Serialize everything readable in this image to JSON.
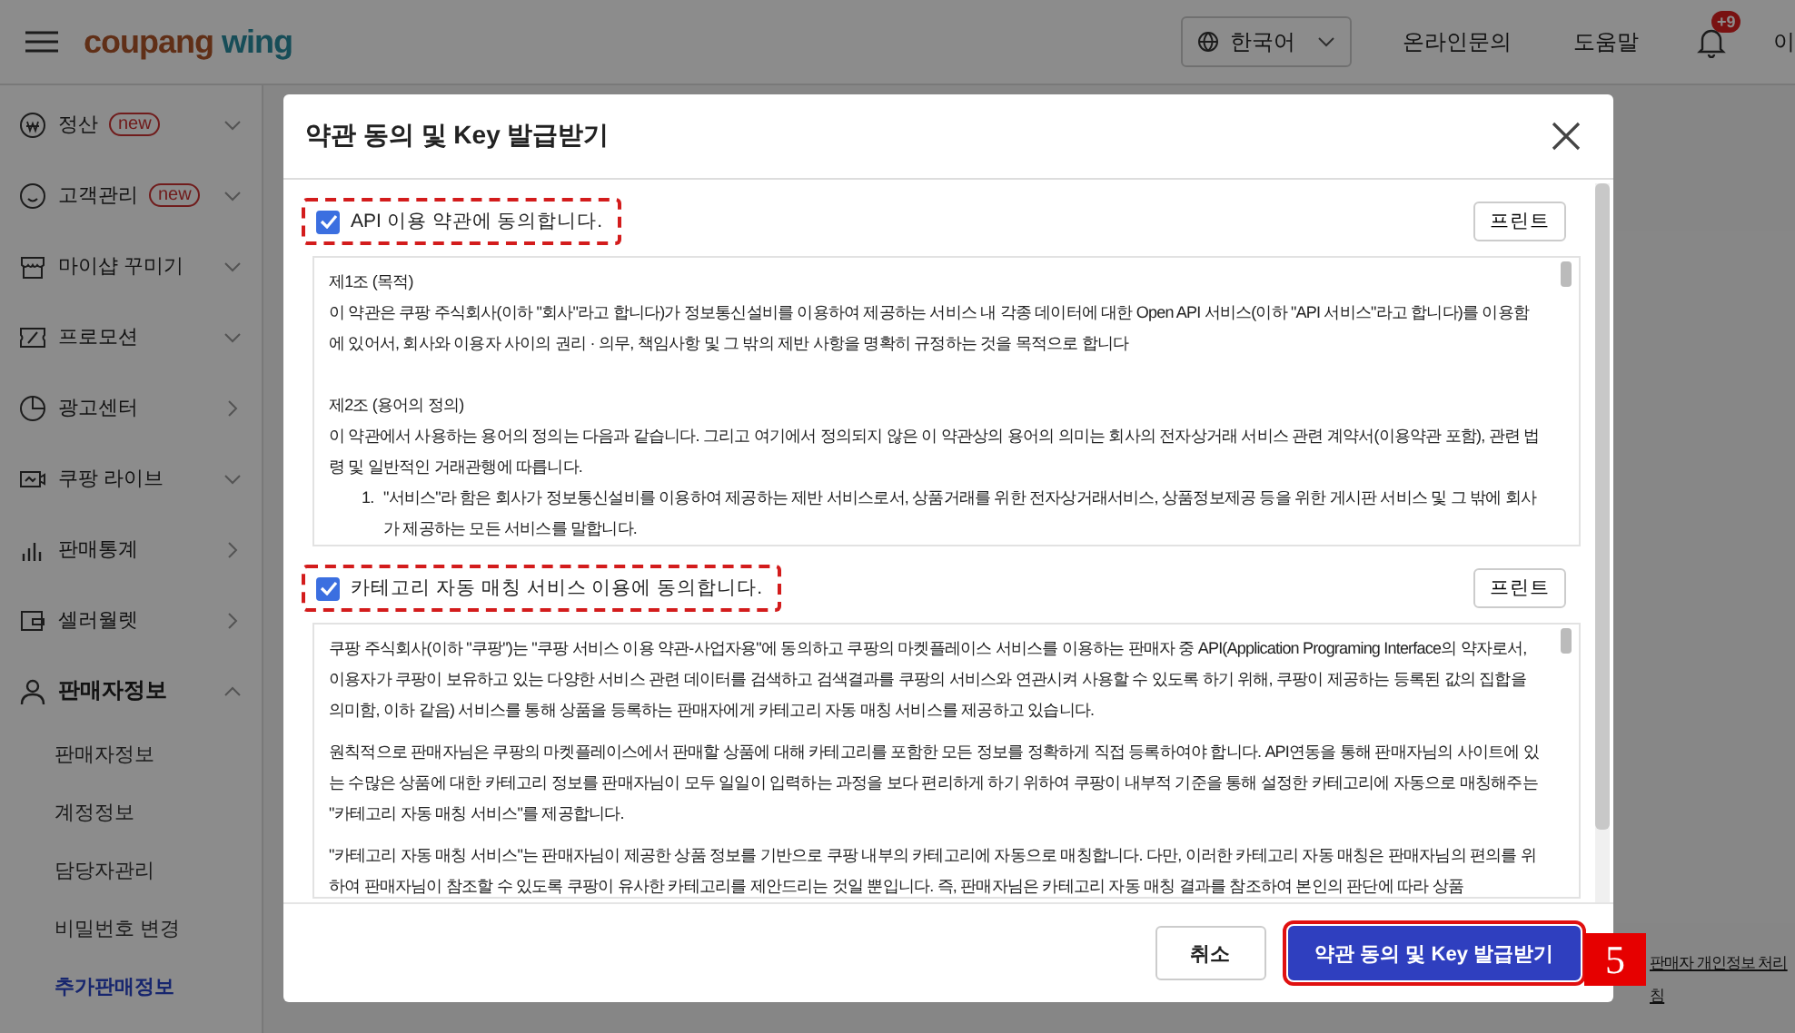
{
  "header": {
    "logo": {
      "brand": "coupang",
      "product": "wing"
    },
    "language": "한국어",
    "links": [
      "온라인문의",
      "도움말"
    ],
    "notification_badge": "+9",
    "user_initial": "이"
  },
  "sidebar": {
    "items": [
      {
        "label": "정산",
        "badge": "new",
        "expandable": true,
        "expanded": false
      },
      {
        "label": "고객관리",
        "badge": "new",
        "expandable": true,
        "expanded": false
      },
      {
        "label": "마이샵 꾸미기",
        "expandable": true,
        "expanded": false
      },
      {
        "label": "프로모션",
        "expandable": true,
        "expanded": false
      },
      {
        "label": "광고센터",
        "expandable": false,
        "expanded": false
      },
      {
        "label": "쿠팡 라이브",
        "expandable": true,
        "expanded": false
      },
      {
        "label": "판매통계",
        "expandable": false,
        "expanded": false
      },
      {
        "label": "셀러월렛",
        "expandable": false,
        "expanded": false
      },
      {
        "label": "판매자정보",
        "expandable": true,
        "expanded": true,
        "children": [
          {
            "label": "판매자정보",
            "selected": false
          },
          {
            "label": "계정정보",
            "selected": false
          },
          {
            "label": "담당자관리",
            "selected": false
          },
          {
            "label": "비밀번호 변경",
            "selected": false
          },
          {
            "label": "추가판매정보",
            "selected": true
          }
        ]
      }
    ]
  },
  "background_link": [
    "판매자 개인정보 처리",
    "침"
  ],
  "modal": {
    "title": "약관 동의 및 Key 발급받기",
    "sections": [
      {
        "agree_label": "API 이용 약관에 동의합니다.",
        "checked": true,
        "highlighted": true,
        "print_button": "프린트",
        "paragraphs": [
          {
            "kind": "heading",
            "text": "제1조 (목적)"
          },
          {
            "kind": "text",
            "text": "이 약관은 쿠팡 주식회사(이하 \"회사\"라고 합니다)가 정보통신설비를 이용하여 제공하는 서비스 내 각종 데이터에 대한 Open API 서비스(이하 \"API 서비스\"라고 합니다)를 이용함에 있어서, 회사와 이용자 사이의 권리 · 의무, 책임사항 및 그 밖의 제반 사항을 명확히 규정하는 것을 목적으로 합니다"
          },
          {
            "kind": "heading",
            "text": "제2조 (용어의 정의)"
          },
          {
            "kind": "text",
            "text": "이 약관에서 사용하는 용어의 정의는 다음과 같습니다. 그리고 여기에서 정의되지 않은 이 약관상의 용어의 의미는 회사의 전자상거래 서비스 관련 계약서(이용약관 포함), 관련 법령 및 일반적인 거래관행에 따릅니다."
          },
          {
            "kind": "list_item",
            "marker": "1.",
            "text": "\"서비스\"라 함은 회사가 정보통신설비를 이용하여 제공하는 제반 서비스로서, 상품거래를 위한 전자상거래서비스, 상품정보제공 등을 위한 게시판 서비스 및 그 밖에 회사가 제공하는 모든 서비스를 말합니다."
          }
        ]
      },
      {
        "agree_label": "카테고리 자동 매칭 서비스 이용에 동의합니다.",
        "checked": true,
        "highlighted": true,
        "print_button": "프린트",
        "paragraphs": [
          {
            "kind": "text",
            "text": "쿠팡 주식회사(이하 \"쿠팡\")는 \"쿠팡 서비스 이용 약관-사업자용\"에 동의하고 쿠팡의 마켓플레이스 서비스를 이용하는 판매자 중 API(Application Programing Interface의 약자로서, 이용자가 쿠팡이 보유하고 있는 다양한 서비스 관련 데이터를 검색하고 검색결과를 쿠팡의 서비스와 연관시켜 사용할 수 있도록 하기 위해, 쿠팡이 제공하는 등록된 값의 집합을 의미함, 이하 같음) 서비스를 통해 상품을 등록하는 판매자에게 카테고리 자동 매칭 서비스를 제공하고 있습니다."
          },
          {
            "kind": "text",
            "text": "원칙적으로 판매자님은 쿠팡의 마켓플레이스에서 판매할 상품에 대해 카테고리를 포함한 모든 정보를 정확하게 직접 등록하여야 합니다. API연동을 통해 판매자님의 사이트에 있는 수많은 상품에 대한 카테고리 정보를 판매자님이 모두 일일이 입력하는 과정을 보다 편리하게 하기 위하여 쿠팡이 내부적 기준을 통해 설정한 카테고리에 자동으로 매칭해주는 \"카테고리 자동 매칭 서비스\"를 제공합니다."
          },
          {
            "kind": "text",
            "text": "\"카테고리 자동 매칭 서비스\"는 판매자님이 제공한 상품 정보를 기반으로 쿠팡 내부의 카테고리에 자동으로 매칭합니다. 다만, 이러한 카테고리 자동 매칭은 판매자님의 편의를 위하여 판매자님이 참조할 수 있도록 쿠팡이 유사한 카테고리를 제안드리는 것일 뿐입니다. 즉, 판매자님은 카테고리 자동 매칭 결과를 참조하여 본인의 판단에 따라 상품"
          }
        ]
      }
    ],
    "buttons": [
      {
        "label": "취소",
        "kind": "secondary",
        "highlighted": false
      },
      {
        "label": "약관 동의 및 Key 발급받기",
        "kind": "primary",
        "highlighted": true
      }
    ]
  },
  "annotation": {
    "step": "5"
  }
}
